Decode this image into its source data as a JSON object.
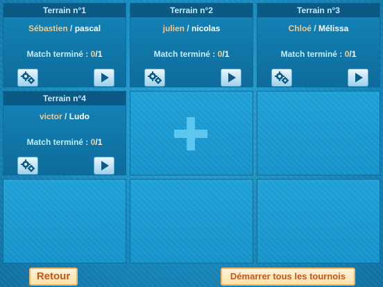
{
  "courts": [
    {
      "title": "Terrain n°1",
      "player1": "Sébastien",
      "separator": "/",
      "player2": "pascal",
      "status_label": "Match terminé :",
      "played": "0",
      "slash": "/",
      "total": "1"
    },
    {
      "title": "Terrain n°2",
      "player1": "julien",
      "separator": "/",
      "player2": "nicolas",
      "status_label": "Match terminé :",
      "played": "0",
      "slash": "/",
      "total": "1"
    },
    {
      "title": "Terrain n°3",
      "player1": "Chloé",
      "separator": "/",
      "player2": "Mélissa",
      "status_label": "Match terminé :",
      "played": "0",
      "slash": "/",
      "total": "1"
    },
    {
      "title": "Terrain n°4",
      "player1": "victor",
      "separator": "/",
      "player2": "Ludo",
      "status_label": "Match terminé :",
      "played": "0",
      "slash": "/",
      "total": "1"
    }
  ],
  "add_court_icon": "plus-icon",
  "icons": {
    "settings": "gear-icon",
    "play": "play-icon"
  },
  "footer": {
    "back_label": "Retour",
    "start_all_label": "Démarrer tous les tournois"
  }
}
